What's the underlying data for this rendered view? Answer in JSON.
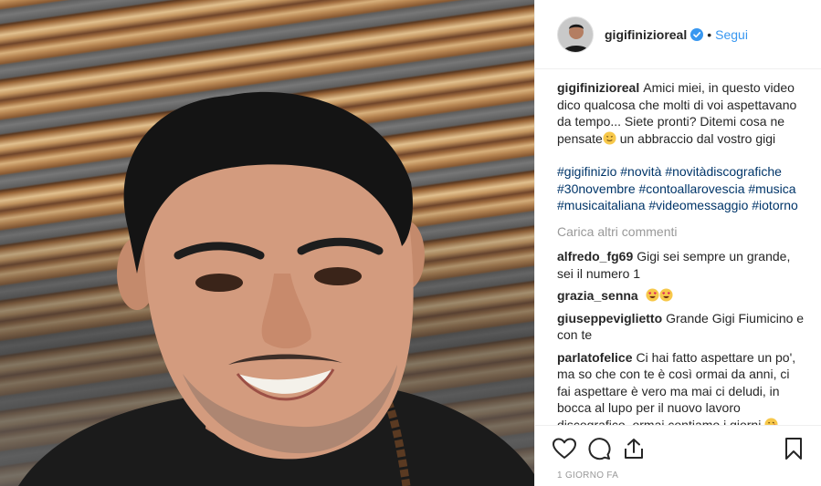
{
  "header": {
    "username": "gigifinizioreal",
    "separator": "•",
    "follow_label": "Segui"
  },
  "caption": {
    "username": "gigifinizioreal",
    "text_1": "Amici miei, in questo video dico qualcosa che molti di voi aspettavano da tempo... Siete pronti? Ditemi cosa ne pensate",
    "text_2": " un abbraccio dal vostro gigi",
    "hashtags": [
      "#gigifinizio",
      "#novità",
      "#novitàdiscografiche",
      "#30novembre",
      "#contoallarovescia",
      "#musica",
      "#musicaitaliana",
      "#videomessaggio",
      "#iotorno"
    ]
  },
  "load_more_label": "Carica altri commenti",
  "comments": [
    {
      "username": "alfredo_fg69",
      "text": "Gigi sei sempre un grande, sei il numero 1"
    },
    {
      "username": "grazia_senna",
      "text": ""
    },
    {
      "username": "giuseppeviglietto",
      "text": "Grande Gigi Fiumicino e con te"
    },
    {
      "username": "parlatofelice",
      "text": "Ci hai fatto aspettare un po', ma so che con te è così ormai da anni, ci fai aspettare è vero ma mai ci deludi, in bocca al lupo per il nuovo lavoro discografico, ormai contiamo i giorni"
    }
  ],
  "timestamp": "1 GIORNO FA",
  "icons": {
    "verified": "verified-badge-icon",
    "like": "heart-icon",
    "comment": "comment-bubble-icon",
    "share": "share-icon",
    "save": "bookmark-icon",
    "emoji_caption": "sweat-smile-emoji",
    "emoji_heart_eyes": "heart-eyes-emoji",
    "emoji_kiss": "kiss-emoji"
  },
  "colors": {
    "link_blue": "#3897f0",
    "hashtag": "#003569",
    "muted": "#999999",
    "text": "#262626"
  }
}
